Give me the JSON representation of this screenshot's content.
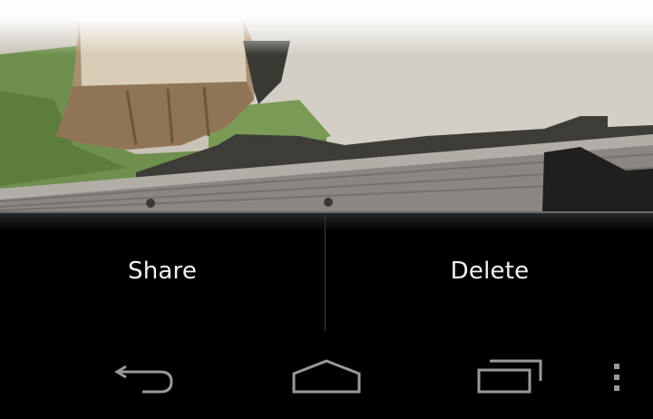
{
  "action_bar": {
    "share_label": "Share",
    "delete_label": "Delete"
  },
  "photo": {
    "description_icon": "photo-content"
  },
  "navigation": {
    "icons": [
      "back-icon",
      "home-icon",
      "recent-apps-icon",
      "overflow-menu-icon"
    ]
  },
  "colors": {
    "bar_background": "#000000",
    "text": "#f2f2f2",
    "icon": "#9a9a9a"
  }
}
